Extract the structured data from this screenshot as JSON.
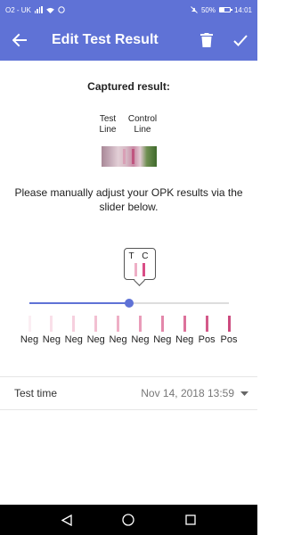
{
  "status_bar": {
    "carrier": "O2 - UK",
    "battery_percent": "50%",
    "battery_level": 0.5,
    "time": "14:01",
    "icons": [
      "signal-icon",
      "wifi-icon",
      "whatsapp-icon",
      "mute-icon",
      "battery-icon"
    ]
  },
  "app_bar": {
    "title": "Edit Test Result",
    "back_icon": "arrow-left-icon",
    "delete_icon": "trash-icon",
    "confirm_icon": "check-icon"
  },
  "captured": {
    "label": "Captured result:",
    "test_line_label": "Test\nLine",
    "control_line_label": "Control\nLine"
  },
  "instructions": "Please manually adjust your OPK results via the slider below.",
  "slider": {
    "tooltip_letters": "T C",
    "selected_index": 5,
    "selected_fraction": 0.5,
    "ticks": [
      "Neg",
      "Neg",
      "Neg",
      "Neg",
      "Neg",
      "Neg",
      "Neg",
      "Neg",
      "Pos",
      "Pos"
    ],
    "swatch_colors": [
      "#fbeef3",
      "#f9e0e9",
      "#f6d0de",
      "#f2c0d2",
      "#eeafc6",
      "#e99cb9",
      "#e387aa",
      "#dc729b",
      "#d45a8a",
      "#cc4a7e"
    ],
    "tooltip_test_color": "#eeafc6",
    "tooltip_control_color": "#d94d86",
    "accent": "#5f72d6"
  },
  "test_time": {
    "label": "Test time",
    "value": "Nov 14, 2018 13:59",
    "dropdown_icon": "caret-down-icon"
  },
  "nav_bar": {
    "icons": [
      "back-triangle-icon",
      "home-circle-icon",
      "recents-square-icon"
    ]
  }
}
